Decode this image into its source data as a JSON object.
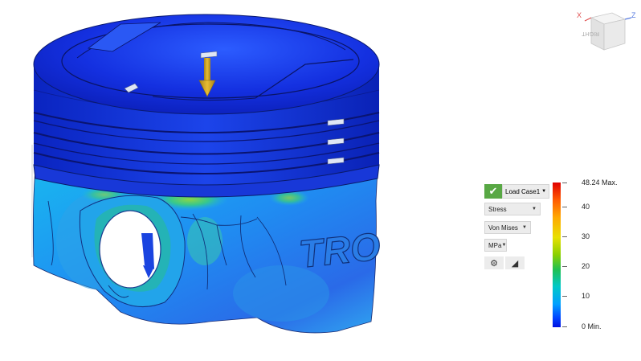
{
  "viewcube": {
    "face_label": "RIGHT",
    "axis_x": "X",
    "axis_z": "Z"
  },
  "model": {
    "engraving": "TRO"
  },
  "results": {
    "load_case": "Load Case1",
    "result_type": "Stress",
    "stress_type": "Von Mises",
    "unit": "MPa"
  },
  "legend": {
    "max_label": "48.24 Max.",
    "min_label": "0 Min.",
    "ticks": [
      "40",
      "30",
      "20",
      "10"
    ]
  },
  "colors": {
    "check": "#58a844",
    "min_blue": "#0010e0",
    "max_red": "#e00000"
  }
}
